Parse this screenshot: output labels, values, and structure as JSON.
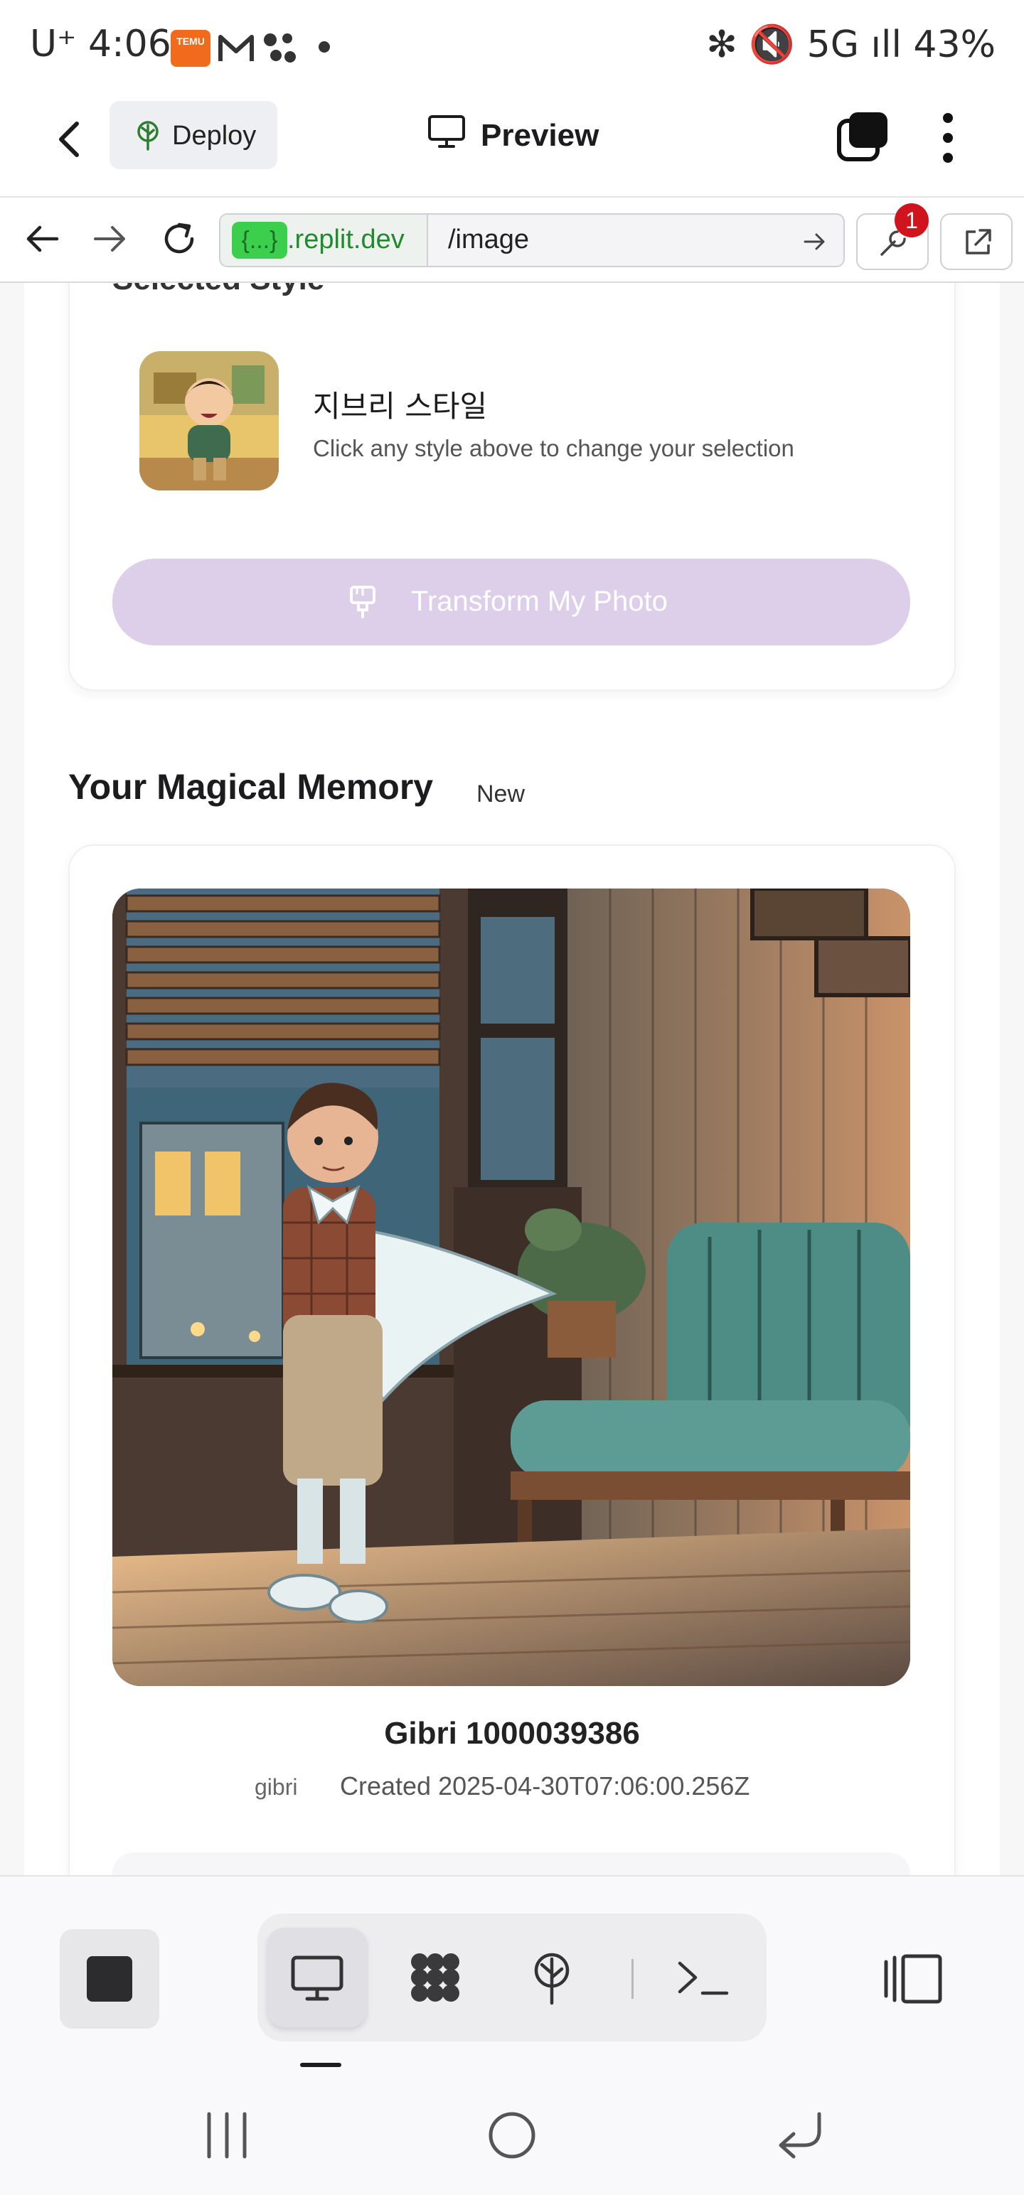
{
  "status_bar": {
    "time": "U⁺ 4:06",
    "temu_label": "TEMU",
    "right": "✻ 🔇 5G ıll 43%"
  },
  "top_bar": {
    "deploy_label": "Deploy",
    "preview_label": "Preview"
  },
  "browser": {
    "domain_braces": "{...}",
    "domain": ".replit.dev",
    "path": "/image",
    "devtools_badge": "1"
  },
  "page": {
    "cut_title": "Selected Style",
    "style_name": "지브리 스타일",
    "style_hint": "Click any style above to change your selection",
    "transform_button": "Transform My Photo",
    "section_title": "Your Magical Memory",
    "new_tag": "New",
    "image_title": "Gibri 1000039386",
    "image_tag": "gibri",
    "image_created": "Created 2025-04-30T07:06:00.256Z"
  },
  "colors": {
    "accent_purple_disabled": "#ddcfe9",
    "replit_green": "#3ccf4e",
    "badge_red": "#d0141e"
  },
  "icons": {
    "deploy": "deploy-tree-icon",
    "preview": "monitor-icon",
    "tabs": "tabs-icon",
    "menu": "kebab-icon",
    "toolbar": [
      "stop-icon",
      "monitor-icon",
      "workspace-icon",
      "deploy-tree-icon",
      "terminal-icon",
      "layout-icon"
    ]
  }
}
